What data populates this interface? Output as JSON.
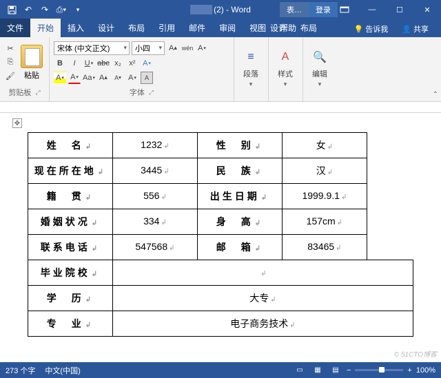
{
  "titlebar": {
    "doc_suffix": "(2) - Word",
    "table_tools": "表…",
    "login": "登录"
  },
  "tabs": {
    "file": "文件",
    "home": "开始",
    "insert": "插入",
    "design": "设计",
    "layout": "布局",
    "references": "引用",
    "mailings": "邮件",
    "review": "审阅",
    "view": "视图",
    "help": "帮助",
    "t_design": "设计",
    "t_layout": "布局",
    "tell_me": "告诉我",
    "share": "共享"
  },
  "ribbon": {
    "paste": "粘贴",
    "clipboard": "剪贴板",
    "font_name": "宋体 (中文正文)",
    "font_size": "小四",
    "wen": "wén",
    "font_group": "字体",
    "paragraph": "段落",
    "styles": "样式",
    "editing": "编辑"
  },
  "table": {
    "r1c1": "姓　名",
    "r1c2": "1232",
    "r1c3": "性　别",
    "r1c4": "女",
    "r2c1": "现在所在地",
    "r2c2": "3445",
    "r2c3": "民　族",
    "r2c4": "汉",
    "r3c1": "籍　贯",
    "r3c2": "556",
    "r3c3": "出生日期",
    "r3c4": "1999.9.1",
    "r4c1": "婚姻状况",
    "r4c2": "334",
    "r4c3": "身　高",
    "r4c4": "157cm",
    "r5c1": "联系电话",
    "r5c2": "547568",
    "r5c3": "邮　箱",
    "r5c4": "83465",
    "r6c1": "毕业院校",
    "r6c2": "",
    "r7c1": "学　历",
    "r7c2": "大专",
    "r8c1": "专　业",
    "r8c2": "电子商务技术"
  },
  "status": {
    "words": "273 个字",
    "lang": "中文(中国)",
    "zoom": "100%"
  },
  "watermark": "© 51CTO博客"
}
